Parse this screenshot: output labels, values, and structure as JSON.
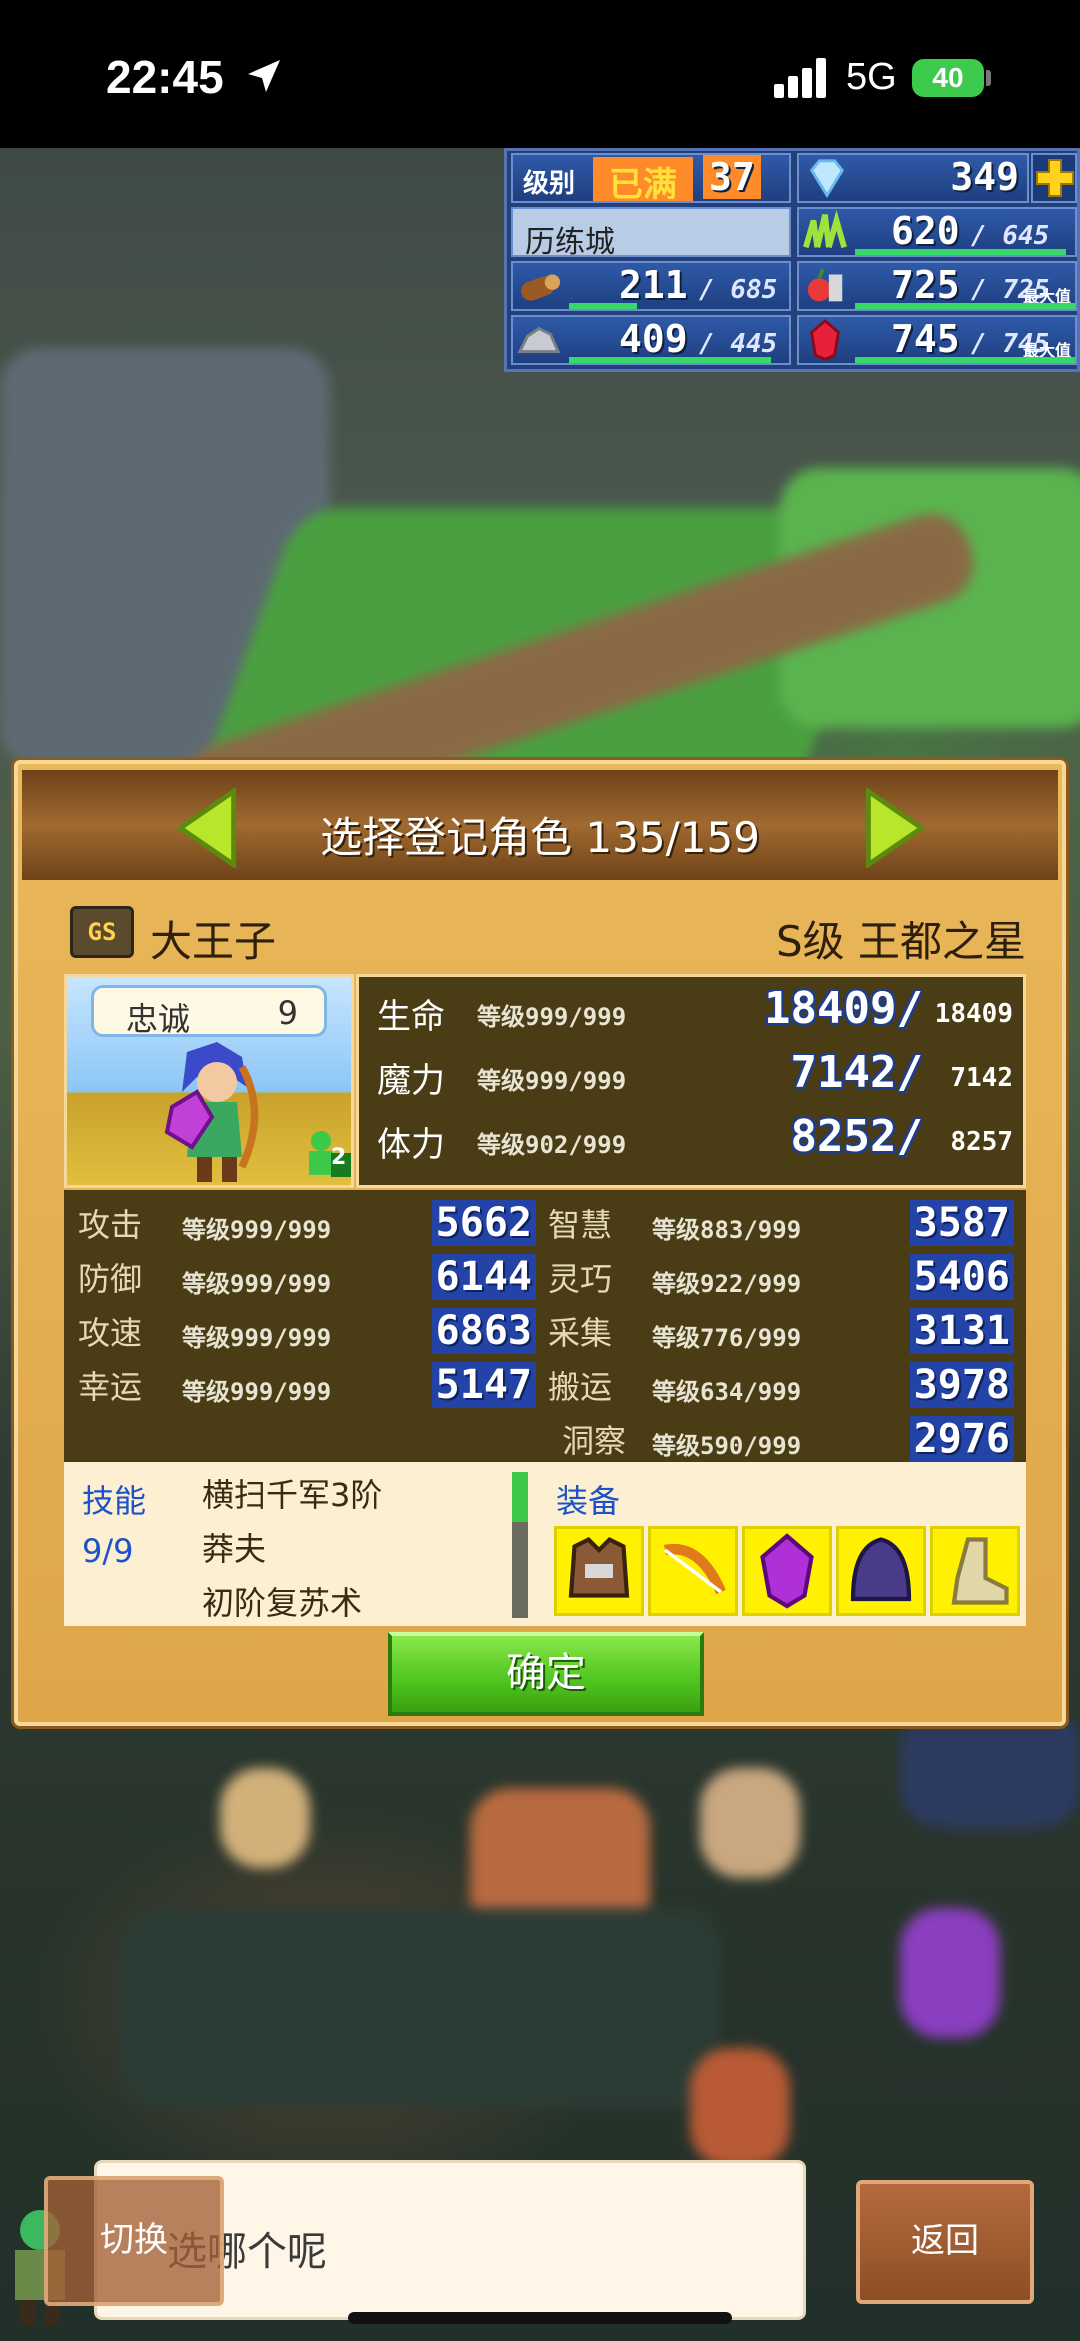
{
  "status_bar": {
    "time": "22:45",
    "network": "5G",
    "battery": "40"
  },
  "hud": {
    "rank_label": "级别",
    "rank_badge": "已满",
    "rank_value": "37",
    "gems": "349",
    "town_name": "历练城",
    "food_current": "620",
    "food_max": "645",
    "wood_current": "211",
    "wood_max": "685",
    "fruit_current": "725",
    "fruit_max": "725",
    "fruit_max_tag": "最大值",
    "ore_current": "409",
    "ore_max": "445",
    "crystal_current": "745",
    "crystal_max": "745",
    "crystal_max_tag": "最大值",
    "bar_fill": {
      "food": 0.96,
      "wood": 0.31,
      "fruit": 1.0,
      "ore": 0.92,
      "crystal": 1.0
    }
  },
  "dialog": {
    "title": "选择登记角色 135/159",
    "rank_badge": "GS",
    "character_name": "大王子",
    "character_title": "S级 王都之星",
    "loyalty_label": "忠诚",
    "loyalty_value": "9",
    "party_count": "2",
    "vitals": [
      {
        "label": "生命",
        "level": "等级999/999",
        "current": "18409/",
        "max": "18409"
      },
      {
        "label": "魔力",
        "level": "等级999/999",
        "current": "7142/",
        "max": "7142"
      },
      {
        "label": "体力",
        "level": "等级902/999",
        "current": "8252/",
        "max": "8257"
      }
    ],
    "stats_left": [
      {
        "label": "攻击",
        "level": "等级999/999",
        "value": "5662"
      },
      {
        "label": "防御",
        "level": "等级999/999",
        "value": "6144"
      },
      {
        "label": "攻速",
        "level": "等级999/999",
        "value": "6863"
      },
      {
        "label": "幸运",
        "level": "等级999/999",
        "value": "5147"
      }
    ],
    "stats_right": [
      {
        "label": "智慧",
        "level": "等级883/999",
        "value": "3587"
      },
      {
        "label": "灵巧",
        "level": "等级922/999",
        "value": "5406"
      },
      {
        "label": "采集",
        "level": "等级776/999",
        "value": "3131"
      },
      {
        "label": "搬运",
        "level": "等级634/999",
        "value": "3978"
      },
      {
        "label": "洞察",
        "level": "等级590/999",
        "value": "2976"
      }
    ],
    "skills_label": "技能",
    "skills_count": "9/9",
    "skills": [
      "横扫千军3阶",
      "莽夫",
      "初阶复苏术"
    ],
    "equipment_label": "装备",
    "equipment": [
      "armor-icon",
      "bow-icon",
      "crystal-icon",
      "hood-icon",
      "boots-icon"
    ],
    "confirm_label": "确定"
  },
  "bottom": {
    "message": "选哪个呢",
    "switch_label": "切换",
    "back_label": "返回"
  },
  "colors": {
    "dialog_bg": "#e9b85a",
    "stat_panel": "#4a3c14",
    "confirm_green": "#4ec41e",
    "accent_blue": "#1d52c8"
  }
}
